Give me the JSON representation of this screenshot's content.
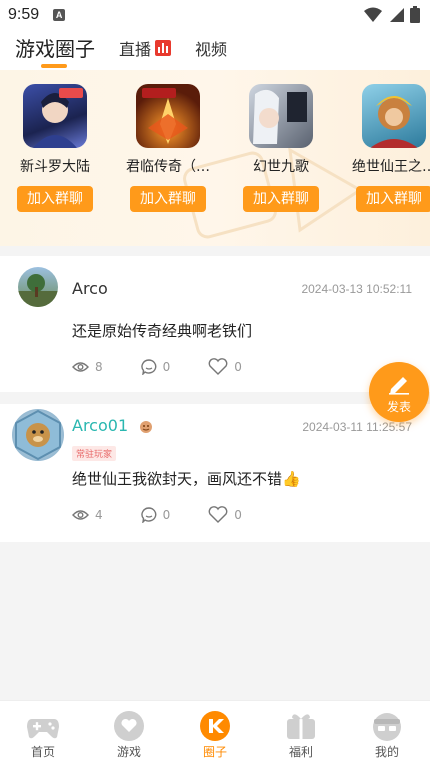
{
  "status_bar": {
    "time": "9:59",
    "notification_letter": "A"
  },
  "top_tabs": [
    {
      "label": "游戏圈子",
      "active": true
    },
    {
      "label": "直播",
      "active": false,
      "icon": "live-icon"
    },
    {
      "label": "视频",
      "active": false
    }
  ],
  "games": [
    {
      "name": "新斗罗大陆",
      "join_label": "加入群聊",
      "icon": "game-douluo-icon"
    },
    {
      "name": "君临传奇（…",
      "join_label": "加入群聊",
      "icon": "game-junlin-icon"
    },
    {
      "name": "幻世九歌",
      "join_label": "加入群聊",
      "icon": "game-huanshi-icon"
    },
    {
      "name": "绝世仙王之…",
      "join_label": "加入群聊",
      "icon": "game-juexian-icon"
    }
  ],
  "posts": [
    {
      "user": "Arco",
      "time": "2024-03-13 10:52:11",
      "content": "还是原始传奇经典啊老铁们",
      "views": "8",
      "comments": "0",
      "likes": "0"
    },
    {
      "user": "Arco01",
      "badge": "常驻玩家",
      "time": "2024-03-11 11:25:57",
      "content": "绝世仙王我欲封天，画风还不错👍",
      "views": "4",
      "comments": "0",
      "likes": "0"
    }
  ],
  "fab": {
    "label": "发表"
  },
  "bottom_nav": [
    {
      "label": "首页",
      "icon": "gamepad-icon",
      "active": false
    },
    {
      "label": "游戏",
      "icon": "heart-bubble-icon",
      "active": false
    },
    {
      "label": "圈子",
      "icon": "circle-icon",
      "active": true
    },
    {
      "label": "福利",
      "icon": "gift-icon",
      "active": false
    },
    {
      "label": "我的",
      "icon": "profile-icon",
      "active": false
    }
  ],
  "colors": {
    "accent": "#ff9a1a",
    "vip_name": "#2ab7b0",
    "live": "#e83a2e"
  }
}
